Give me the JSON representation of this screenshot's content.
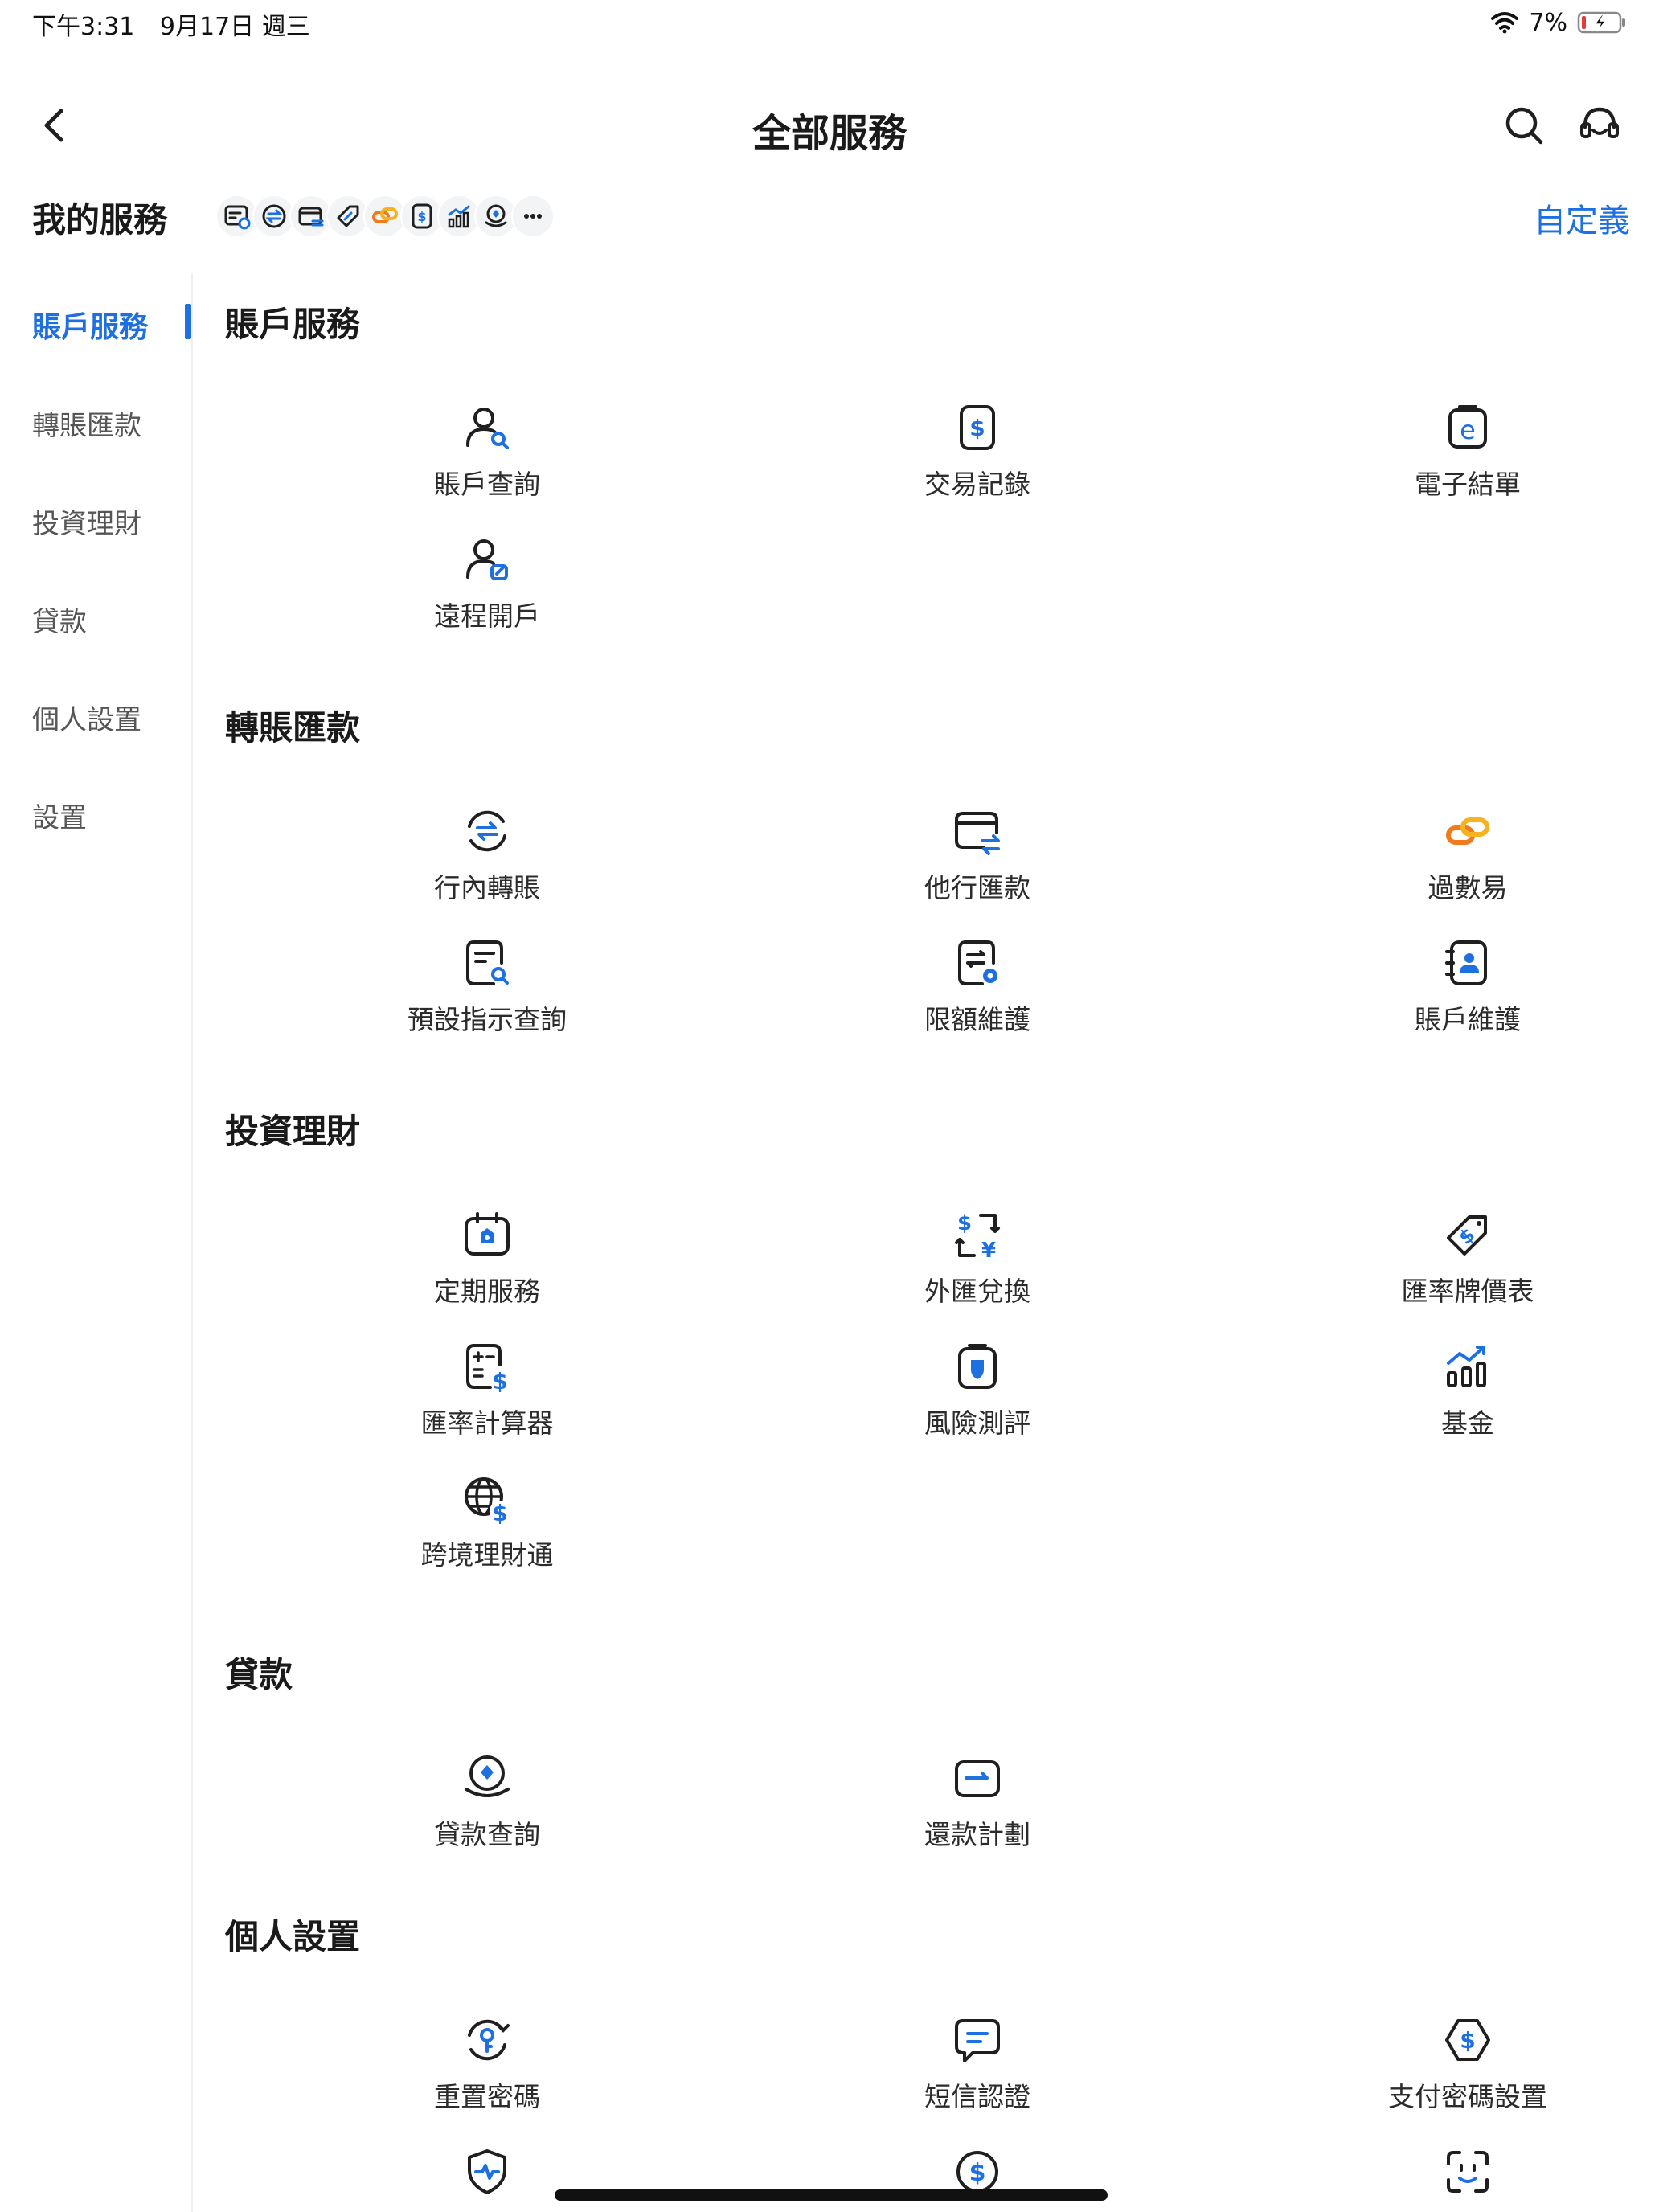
{
  "status_bar": {
    "time": "下午3:31",
    "date": "9月17日 週三",
    "battery": "7%"
  },
  "nav": {
    "title": "全部服務",
    "back_icon": "chevron-left-icon",
    "search_icon": "search-icon",
    "support_icon": "headset-icon"
  },
  "my_services": {
    "title": "我的服務",
    "customize_label": "自定義",
    "shortcuts": [
      "remote-account-icon",
      "internal-transfer-icon",
      "other-bank-remit-icon",
      "rate-tag-icon",
      "fps-icon",
      "transaction-record-icon",
      "fund-icon",
      "loan-query-icon",
      "more-icon"
    ]
  },
  "sidebar": {
    "items": [
      "賬戶服務",
      "轉賬匯款",
      "投資理財",
      "貸款",
      "個人設置",
      "設置"
    ],
    "active": "賬戶服務"
  },
  "sections": [
    {
      "title": "賬戶服務",
      "items": [
        "賬戶查詢",
        "交易記錄",
        "電子結單",
        "遠程開戶"
      ]
    },
    {
      "title": "轉賬匯款",
      "items": [
        "行內轉賬",
        "他行匯款",
        "過數易",
        "預設指示查詢",
        "限額維護",
        "賬戶維護"
      ]
    },
    {
      "title": "投資理財",
      "items": [
        "定期服務",
        "外匯兌換",
        "匯率牌價表",
        "匯率計算器",
        "風險測評",
        "基金",
        "跨境理財通"
      ]
    },
    {
      "title": "貸款",
      "items": [
        "貸款查詢",
        "還款計劃"
      ]
    },
    {
      "title": "個人設置",
      "items": [
        "重置密碼",
        "短信認證",
        "支付密碼設置"
      ]
    }
  ],
  "colors": {
    "accent": "#1e6fe0",
    "icon_dark": "#1f1f1f",
    "fps_orange": "#f07a1c"
  }
}
